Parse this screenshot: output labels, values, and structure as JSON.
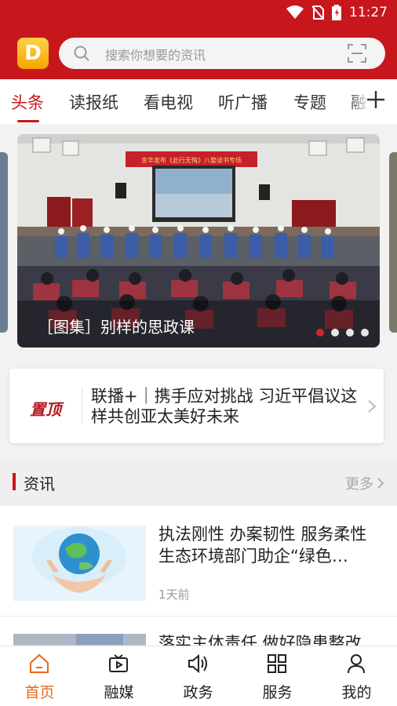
{
  "status_bar": {
    "time": "11:27"
  },
  "search": {
    "placeholder": "搜索你想要的资讯"
  },
  "tabs": [
    {
      "label": "头条",
      "active": true
    },
    {
      "label": "读报纸"
    },
    {
      "label": "看电视"
    },
    {
      "label": "听广播"
    },
    {
      "label": "专题"
    },
    {
      "label": "融"
    }
  ],
  "banner": {
    "title": "［图集］别样的思政课",
    "slide_banner_text": "金华发布《此行无悔》八婺读书专场",
    "active_dot": 0,
    "dot_count": 4
  },
  "headline": {
    "logo": "置顶",
    "text": "联播+｜携手应对挑战  习近平倡议这样共创亚太美好未来"
  },
  "section": {
    "title": "资讯",
    "more": "更多"
  },
  "news": [
    {
      "title": "执法刚性  办案韧性  服务柔性  生态环境部门助企“绿色…",
      "time": "1天前"
    },
    {
      "title": "落实主体责任  做好隐患整改"
    }
  ],
  "bottom_nav": [
    {
      "label": "首页",
      "icon": "home-icon",
      "active": true
    },
    {
      "label": "融媒",
      "icon": "video-icon"
    },
    {
      "label": "政务",
      "icon": "speaker-icon"
    },
    {
      "label": "服务",
      "icon": "grid-icon"
    },
    {
      "label": "我的",
      "icon": "person-icon"
    }
  ],
  "colors": {
    "brand_red": "#c8161d",
    "active_orange": "#e8681c"
  }
}
